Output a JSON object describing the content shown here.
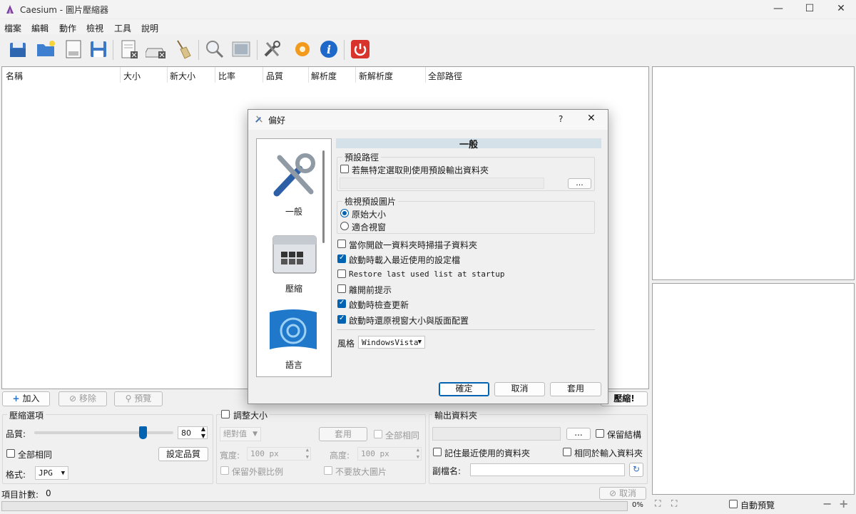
{
  "window": {
    "title": "Caesium - 圖片壓縮器",
    "controls": [
      "—",
      "☐",
      "✕"
    ]
  },
  "menu": [
    "檔案",
    "編輯",
    "動作",
    "檢視",
    "工具",
    "說明"
  ],
  "list": {
    "columns": [
      "名稱",
      "大小",
      "新大小",
      "比率",
      "品質",
      "解析度",
      "新解析度",
      "全部路徑"
    ]
  },
  "list_buttons": {
    "add": "加入",
    "remove": "移除",
    "preview": "預覽",
    "compress": "壓縮!"
  },
  "compression": {
    "title": "壓縮選項",
    "quality_label": "品質:",
    "quality_value": "80",
    "same_for_all": "全部相同",
    "set_quality": "設定品質",
    "format_label": "格式:",
    "format_value": "JPG"
  },
  "resize": {
    "title": "調整大小",
    "mode": "絕對值",
    "apply": "套用",
    "same_for_all": "全部相同",
    "width_label": "寬度:",
    "width_value": "100 px",
    "height_label": "高度:",
    "height_value": "100 px",
    "keep_ratio": "保留外觀比例",
    "no_enlarge": "不要放大圖片"
  },
  "output": {
    "title": "輸出資料夾",
    "browse": "...",
    "keep_structure": "保留結構",
    "remember_last": "記住最近使用的資料夾",
    "same_as_input": "相同於輸入資料夾",
    "suffix_label": "副檔名:"
  },
  "status": {
    "item_count_label": "項目計數:",
    "item_count": "0",
    "cancel": "取消",
    "progress": "0%"
  },
  "preview_panel": {
    "auto_preview": "自動預覽"
  },
  "dialog": {
    "title": "偏好",
    "help": "?",
    "close": "✕",
    "nav": [
      "一般",
      "壓縮",
      "語言"
    ],
    "section_title": "一般",
    "default_path_group": "預設路徑",
    "use_default_output": "若無特定選取則使用預設輸出資料夾",
    "browse": "...",
    "view_default_group": "檢視預設圖片",
    "original_size": "原始大小",
    "fit_window": "適合視窗",
    "scan_subfolders": "當你開啟一資料夾時掃描子資料夾",
    "load_last_settings": "啟動時載入最近使用的設定檔",
    "restore_list": "Restore last used list at startup",
    "prompt_before_exit": "離開前提示",
    "check_updates": "啟動時檢查更新",
    "restore_window": "啟動時還原視窗大小與版面配置",
    "style_label": "風格",
    "style_value": "WindowsVista",
    "ok": "確定",
    "cancel": "取消",
    "apply": "套用"
  }
}
